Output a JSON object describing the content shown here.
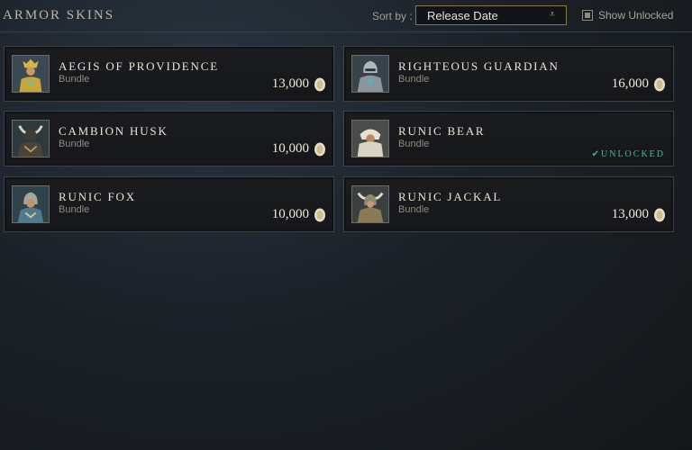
{
  "header": {
    "title": "ARMOR SKINS",
    "sort_label": "Sort by :",
    "sort_value": "Release Date",
    "show_unlocked_label": "Show Unlocked"
  },
  "colors": {
    "accent_gold": "#c7a55c",
    "unlocked_green": "#3fbf8a"
  },
  "items": [
    {
      "name": "AEGIS OF PROVIDENCE",
      "type": "Bundle",
      "price": "13,000",
      "status": "",
      "icon": "golden-armor-portrait"
    },
    {
      "name": "RIGHTEOUS GUARDIAN",
      "type": "Bundle",
      "price": "16,000",
      "status": "",
      "icon": "steel-helm-portrait"
    },
    {
      "name": "CAMBION HUSK",
      "type": "Bundle",
      "price": "10,000",
      "status": "",
      "icon": "horned-helm-portrait"
    },
    {
      "name": "RUNIC BEAR",
      "type": "Bundle",
      "price": "",
      "status": "✔UNLOCKED",
      "icon": "bear-pelt-portrait"
    },
    {
      "name": "RUNIC FOX",
      "type": "Bundle",
      "price": "10,000",
      "status": "",
      "icon": "fox-hood-portrait"
    },
    {
      "name": "RUNIC JACKAL",
      "type": "Bundle",
      "price": "13,000",
      "status": "",
      "icon": "winged-helm-portrait"
    }
  ]
}
